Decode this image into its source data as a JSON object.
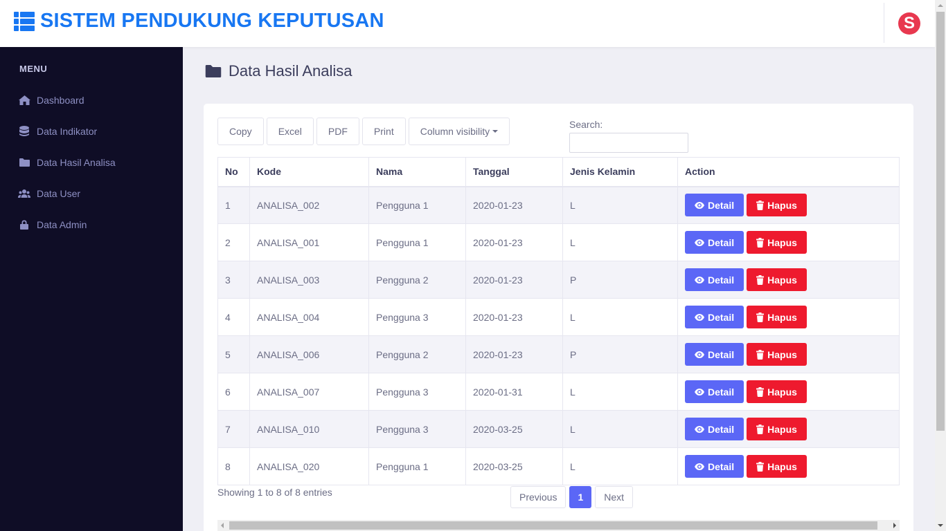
{
  "header": {
    "title": "SISTEM PENDUKUNG KEPUTUSAN",
    "brand_icon": "list-icon",
    "avatar_letter": "S",
    "brand_color": "#1877f2",
    "avatar_color": "#e8384f"
  },
  "sidebar": {
    "menu_label": "MENU",
    "items": [
      {
        "label": "Dashboard",
        "icon": "home-icon"
      },
      {
        "label": "Data Indikator",
        "icon": "database-icon"
      },
      {
        "label": "Data Hasil Analisa",
        "icon": "folder-icon"
      },
      {
        "label": "Data User",
        "icon": "users-icon"
      },
      {
        "label": "Data Admin",
        "icon": "lock-icon"
      }
    ]
  },
  "page": {
    "title": "Data Hasil Analisa",
    "title_icon": "folder-icon"
  },
  "toolbar": {
    "buttons": [
      "Copy",
      "Excel",
      "PDF",
      "Print",
      "Column visibility"
    ],
    "search_label": "Search:",
    "search_value": ""
  },
  "table": {
    "columns": [
      "No",
      "Kode",
      "Nama",
      "Tanggal",
      "Jenis Kelamin",
      "Action"
    ],
    "rows": [
      {
        "no": "1",
        "kode": "ANALISA_002",
        "nama": "Pengguna 1",
        "tanggal": "2020-01-23",
        "jk": "L"
      },
      {
        "no": "2",
        "kode": "ANALISA_001",
        "nama": "Pengguna 1",
        "tanggal": "2020-01-23",
        "jk": "L"
      },
      {
        "no": "3",
        "kode": "ANALISA_003",
        "nama": "Pengguna 2",
        "tanggal": "2020-01-23",
        "jk": "P"
      },
      {
        "no": "4",
        "kode": "ANALISA_004",
        "nama": "Pengguna 3",
        "tanggal": "2020-01-23",
        "jk": "L"
      },
      {
        "no": "5",
        "kode": "ANALISA_006",
        "nama": "Pengguna 2",
        "tanggal": "2020-01-23",
        "jk": "P"
      },
      {
        "no": "6",
        "kode": "ANALISA_007",
        "nama": "Pengguna 3",
        "tanggal": "2020-01-31",
        "jk": "L"
      },
      {
        "no": "7",
        "kode": "ANALISA_010",
        "nama": "Pengguna 3",
        "tanggal": "2020-03-25",
        "jk": "L"
      },
      {
        "no": "8",
        "kode": "ANALISA_020",
        "nama": "Pengguna 1",
        "tanggal": "2020-03-25",
        "jk": "L"
      }
    ],
    "detail_label": "Detail",
    "hapus_label": "Hapus",
    "detail_color": "#5b67f6",
    "hapus_color": "#ee1a2e"
  },
  "footer": {
    "info": "Showing 1 to 8 of 8 entries",
    "previous": "Previous",
    "current_page": "1",
    "next": "Next"
  }
}
